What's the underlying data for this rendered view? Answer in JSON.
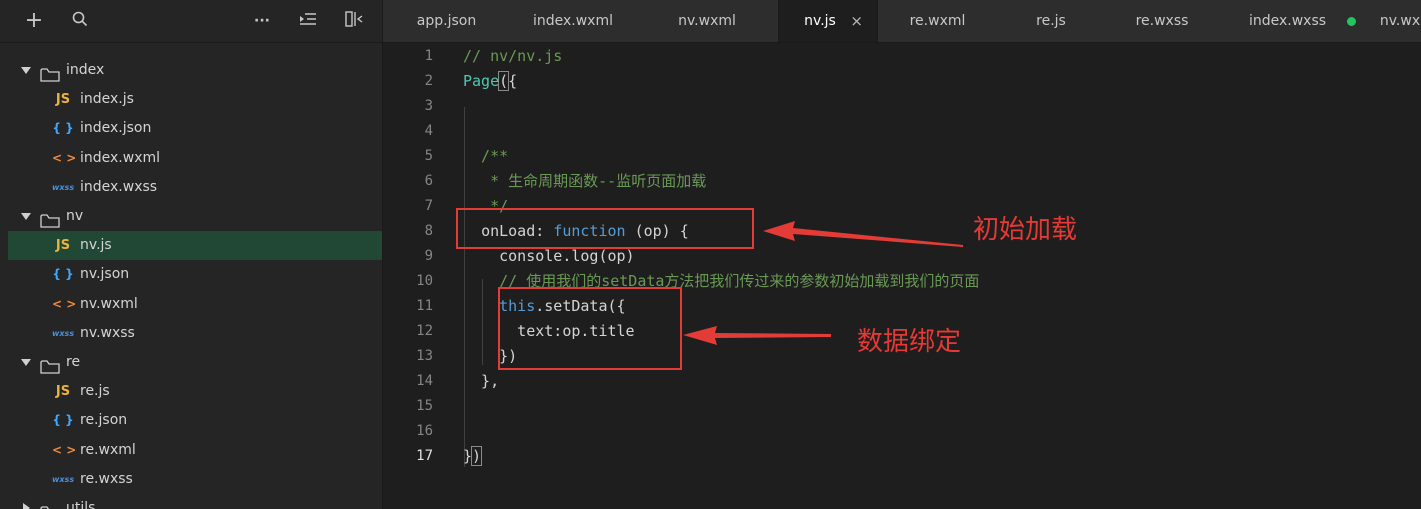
{
  "toolbar": {
    "icons": [
      "plus-icon",
      "search-icon",
      "more-icon",
      "collapse-icon",
      "split-icon"
    ],
    "plus": "+",
    "more": "···"
  },
  "tree": [
    {
      "type": "folder",
      "name": "index",
      "expanded": true
    },
    {
      "type": "file",
      "icon": "JS",
      "kind": "js",
      "name": "index.js"
    },
    {
      "type": "file",
      "icon": "{ }",
      "kind": "json",
      "name": "index.json"
    },
    {
      "type": "file",
      "icon": "< >",
      "kind": "wxml",
      "name": "index.wxml"
    },
    {
      "type": "file",
      "icon": "wxss",
      "kind": "wxss",
      "name": "index.wxss"
    },
    {
      "type": "folder",
      "name": "nv",
      "expanded": true
    },
    {
      "type": "file",
      "icon": "JS",
      "kind": "js",
      "name": "nv.js",
      "selected": true
    },
    {
      "type": "file",
      "icon": "{ }",
      "kind": "json",
      "name": "nv.json"
    },
    {
      "type": "file",
      "icon": "< >",
      "kind": "wxml",
      "name": "nv.wxml"
    },
    {
      "type": "file",
      "icon": "wxss",
      "kind": "wxss",
      "name": "nv.wxss"
    },
    {
      "type": "folder",
      "name": "re",
      "expanded": true
    },
    {
      "type": "file",
      "icon": "JS",
      "kind": "js",
      "name": "re.js"
    },
    {
      "type": "file",
      "icon": "{ }",
      "kind": "json",
      "name": "re.json"
    },
    {
      "type": "file",
      "icon": "< >",
      "kind": "wxml",
      "name": "re.wxml"
    },
    {
      "type": "file",
      "icon": "wxss",
      "kind": "wxss",
      "name": "re.wxss"
    },
    {
      "type": "folder",
      "name": "utils",
      "expanded": false
    }
  ],
  "tabs": [
    {
      "label": "app.json"
    },
    {
      "label": "index.wxml"
    },
    {
      "label": "nv.wxml"
    },
    {
      "label": "nv.js",
      "active": true,
      "close": "×"
    },
    {
      "label": "re.wxml"
    },
    {
      "label": "re.js"
    },
    {
      "label": "re.wxss"
    },
    {
      "label": "index.wxss",
      "modified": true
    },
    {
      "label": "nv.wx"
    }
  ],
  "editor": {
    "current_line": 17,
    "lines": [
      {
        "n": "1",
        "t": "// nv/nv.js"
      },
      {
        "n": "2",
        "t": "Page({"
      },
      {
        "n": "3",
        "t": ""
      },
      {
        "n": "4",
        "t": ""
      },
      {
        "n": "5",
        "t": "  /**"
      },
      {
        "n": "6",
        "t": "   * 生命周期函数--监听页面加载"
      },
      {
        "n": "7",
        "t": "   */"
      },
      {
        "n": "8",
        "t": "  onLoad: function (op) {"
      },
      {
        "n": "9",
        "t": "    console.log(op)"
      },
      {
        "n": "10",
        "t": "    // 使用我们的setData方法把我们传过来的参数初始加载到我们的页面"
      },
      {
        "n": "11",
        "t": "    this.setData({"
      },
      {
        "n": "12",
        "t": "      text:op.title"
      },
      {
        "n": "13",
        "t": "    })"
      },
      {
        "n": "14",
        "t": "  },"
      },
      {
        "n": "15",
        "t": ""
      },
      {
        "n": "16",
        "t": ""
      },
      {
        "n": "17",
        "t": "})"
      }
    ]
  },
  "annotations": {
    "label1": "初始加载",
    "label2": "数据绑定",
    "color": "#e53935"
  }
}
